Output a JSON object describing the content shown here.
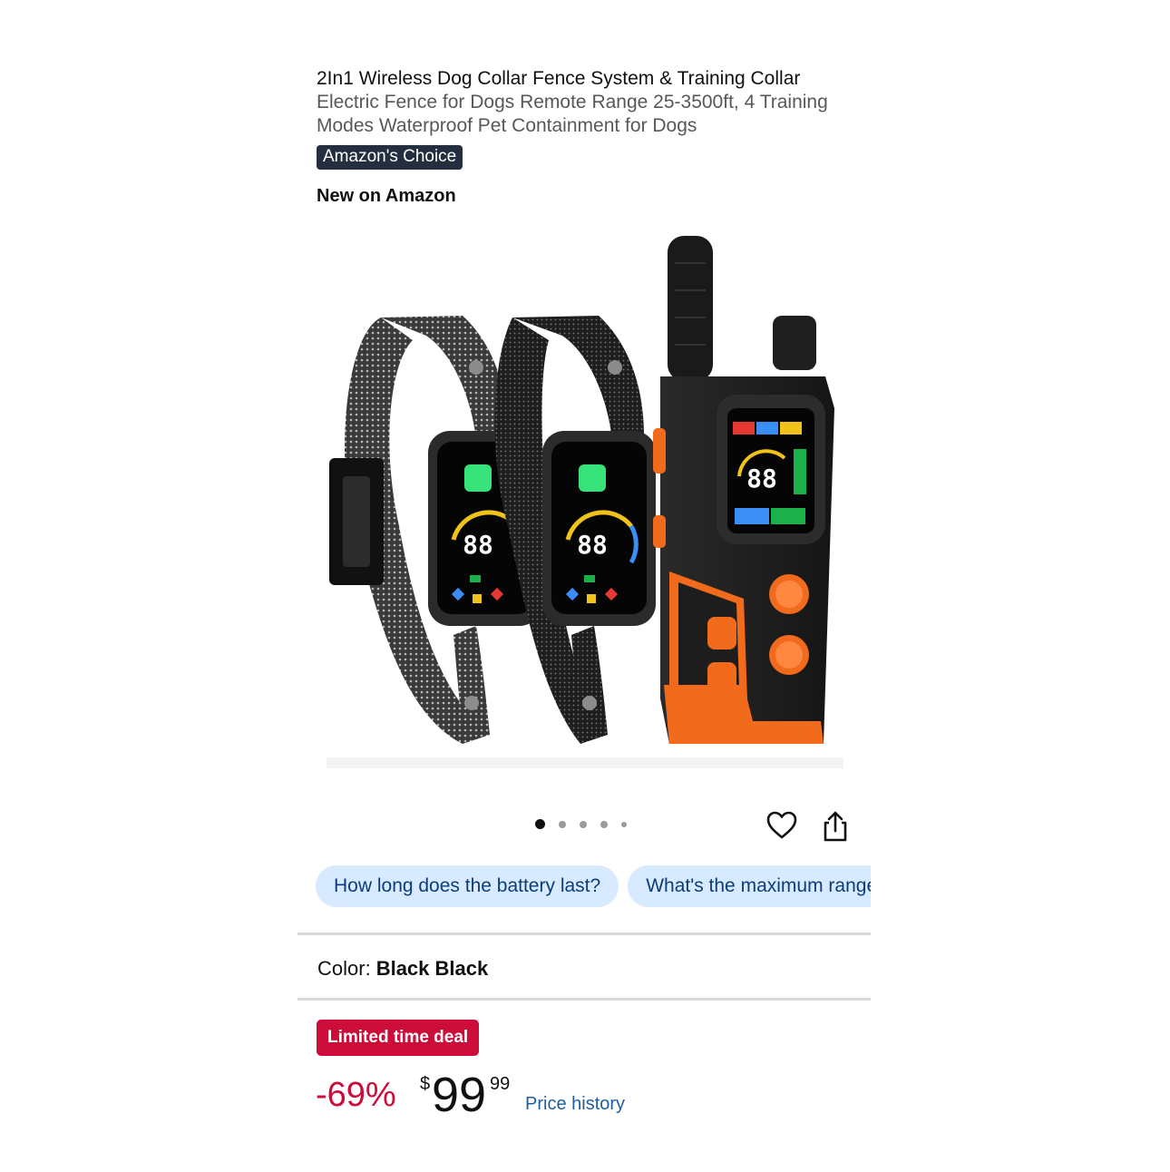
{
  "product": {
    "title_bold": "2In1 Wireless Dog Collar Fence System & Training Collar",
    "title_rest": "Electric Fence for Dogs Remote Range 25-3500ft, 4 Training Modes Waterproof Pet Containment for Dogs",
    "badge": "Amazon's Choice",
    "new_on": "New on Amazon"
  },
  "gallery": {
    "image_count": 5,
    "active_index": 0,
    "icons": [
      "heart-icon",
      "share-icon"
    ],
    "screen_digits": "88"
  },
  "questions": [
    "How long does the battery last?",
    "What's the maximum range?"
  ],
  "color": {
    "label": "Color:",
    "value": "Black Black"
  },
  "deal": {
    "badge": "Limited time deal",
    "discount": "-69%",
    "currency": "$",
    "whole": "99",
    "cents": "99",
    "history_link": "Price history"
  },
  "colors": {
    "deal_red": "#cc0c39",
    "badge_navy": "#232f3e",
    "chip_blue": "#d7eaff",
    "link_blue": "#1d5e9f",
    "accent_orange": "#f26b1d"
  }
}
